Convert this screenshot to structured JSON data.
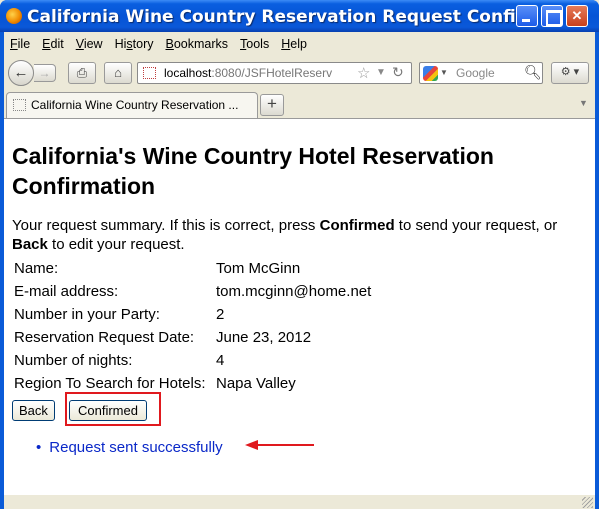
{
  "window": {
    "title": "California Wine Country Reservation Request Confi…",
    "minimize_label": "",
    "maximize_label": "",
    "close_label": "✕"
  },
  "menu": [
    {
      "underline": "F",
      "rest": "ile"
    },
    {
      "underline": "E",
      "rest": "dit"
    },
    {
      "underline": "V",
      "rest": "iew"
    },
    {
      "pre": "Hi",
      "underline": "s",
      "rest": "tory"
    },
    {
      "underline": "B",
      "rest": "ookmarks"
    },
    {
      "underline": "T",
      "rest": "ools"
    },
    {
      "underline": "H",
      "rest": "elp"
    }
  ],
  "toolbar": {
    "url_host": "localhost",
    "url_rest": ":8080/JSFHotelReserv",
    "search_placeholder": "Google"
  },
  "tab": {
    "title": "California Wine Country Reservation ...",
    "new_tab_label": "+"
  },
  "page": {
    "title": "California's Wine Country Hotel Reservation Confirmation",
    "intro_part1": "Your request summary. If this is correct, press ",
    "intro_bold1": "Confirmed",
    "intro_part2": " to send your request, or ",
    "intro_bold2": "Back",
    "intro_part3": " to edit your request.",
    "summary": [
      {
        "label": "Name:",
        "value": "Tom McGinn"
      },
      {
        "label": "E-mail address:",
        "value": "tom.mcginn@home.net"
      },
      {
        "label": "Number in your Party:",
        "value": "2"
      },
      {
        "label": "Reservation Request Date:",
        "value": "June 23, 2012"
      },
      {
        "label": "Number of nights:",
        "value": "4"
      },
      {
        "label": "Region To Search for Hotels:",
        "value": "Napa Valley"
      }
    ],
    "back_button": "Back",
    "confirmed_button": "Confirmed",
    "messages": [
      "Request sent successfully"
    ]
  },
  "colors": {
    "annotation_red": "#e0191e",
    "message_blue": "#0a28c8"
  }
}
